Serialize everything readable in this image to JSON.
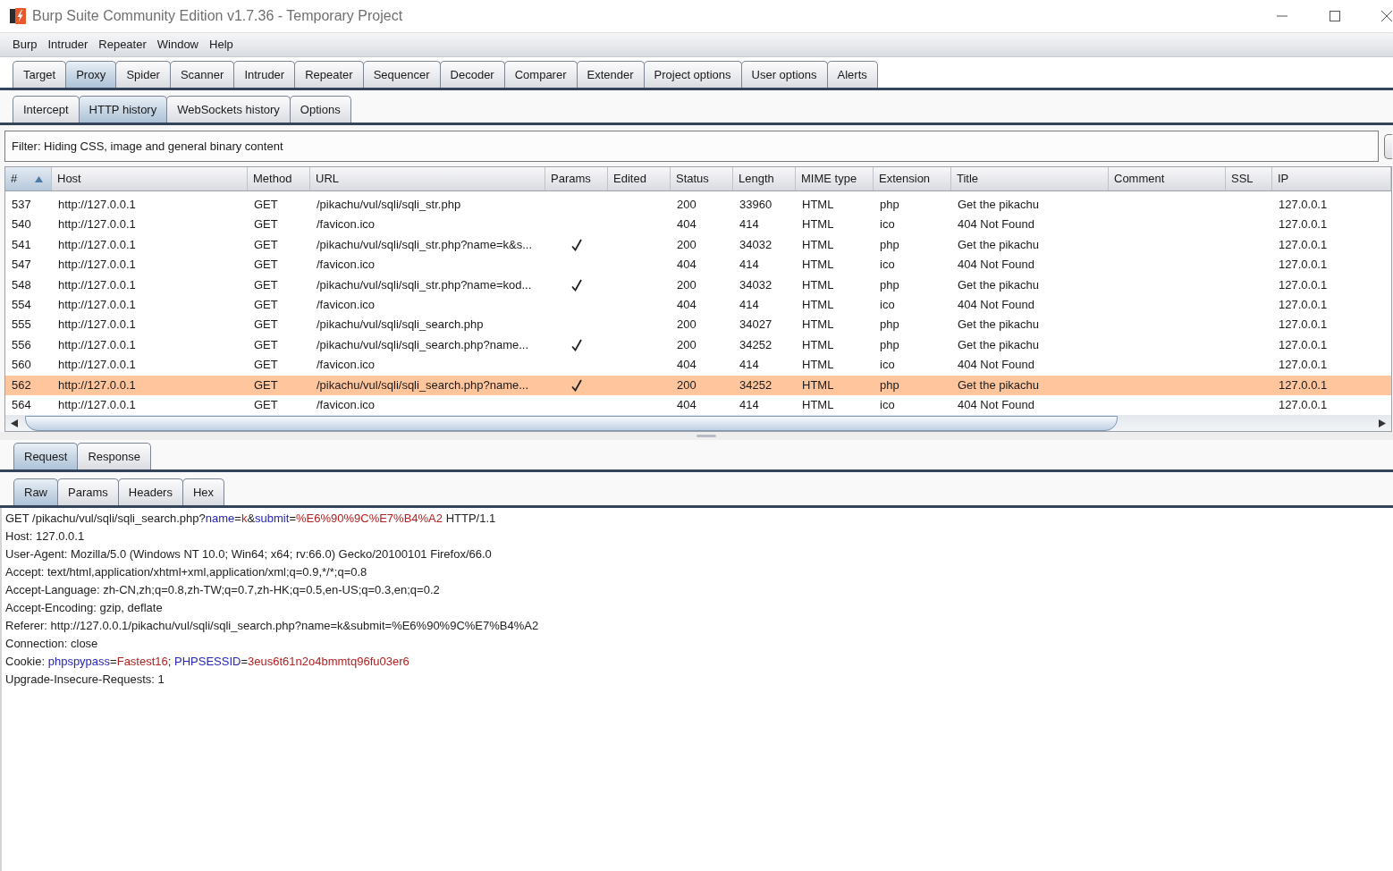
{
  "window": {
    "title": "Burp Suite Community Edition v1.7.36 - Temporary Project"
  },
  "menu": [
    "Burp",
    "Intruder",
    "Repeater",
    "Window",
    "Help"
  ],
  "main_tabs": [
    {
      "label": "Target",
      "selected": false
    },
    {
      "label": "Proxy",
      "selected": true
    },
    {
      "label": "Spider",
      "selected": false
    },
    {
      "label": "Scanner",
      "selected": false
    },
    {
      "label": "Intruder",
      "selected": false
    },
    {
      "label": "Repeater",
      "selected": false
    },
    {
      "label": "Sequencer",
      "selected": false
    },
    {
      "label": "Decoder",
      "selected": false
    },
    {
      "label": "Comparer",
      "selected": false
    },
    {
      "label": "Extender",
      "selected": false
    },
    {
      "label": "Project options",
      "selected": false
    },
    {
      "label": "User options",
      "selected": false
    },
    {
      "label": "Alerts",
      "selected": false
    }
  ],
  "proxy_tabs": [
    {
      "label": "Intercept",
      "selected": false
    },
    {
      "label": "HTTP history",
      "selected": true
    },
    {
      "label": "WebSockets history",
      "selected": false
    },
    {
      "label": "Options",
      "selected": false
    }
  ],
  "filter": {
    "text": "Filter: Hiding CSS, image and general binary content"
  },
  "history_table": {
    "columns": [
      {
        "label": "#",
        "sorted": true
      },
      {
        "label": "Host",
        "sorted": false
      },
      {
        "label": "Method",
        "sorted": false
      },
      {
        "label": "URL",
        "sorted": false
      },
      {
        "label": "Params",
        "sorted": false
      },
      {
        "label": "Edited",
        "sorted": false
      },
      {
        "label": "Status",
        "sorted": false
      },
      {
        "label": "Length",
        "sorted": false
      },
      {
        "label": "MIME type",
        "sorted": false
      },
      {
        "label": "Extension",
        "sorted": false
      },
      {
        "label": "Title",
        "sorted": false
      },
      {
        "label": "Comment",
        "sorted": false
      },
      {
        "label": "SSL",
        "sorted": false
      },
      {
        "label": "IP",
        "sorted": false
      }
    ],
    "rows": [
      {
        "number": "537",
        "host": "http://127.0.0.1",
        "method": "GET",
        "url": "/pikachu/vul/sqli/sqli_str.php",
        "params": false,
        "status": "200",
        "length": "33960",
        "mime_type": "HTML",
        "extension": "php",
        "title": "Get the pikachu",
        "ip": "127.0.0.1",
        "selected": false
      },
      {
        "number": "540",
        "host": "http://127.0.0.1",
        "method": "GET",
        "url": "/favicon.ico",
        "params": false,
        "status": "404",
        "length": "414",
        "mime_type": "HTML",
        "extension": "ico",
        "title": "404 Not Found",
        "ip": "127.0.0.1",
        "selected": false
      },
      {
        "number": "541",
        "host": "http://127.0.0.1",
        "method": "GET",
        "url": "/pikachu/vul/sqli/sqli_str.php?name=k&s...",
        "params": true,
        "status": "200",
        "length": "34032",
        "mime_type": "HTML",
        "extension": "php",
        "title": "Get the pikachu",
        "ip": "127.0.0.1",
        "selected": false
      },
      {
        "number": "547",
        "host": "http://127.0.0.1",
        "method": "GET",
        "url": "/favicon.ico",
        "params": false,
        "status": "404",
        "length": "414",
        "mime_type": "HTML",
        "extension": "ico",
        "title": "404 Not Found",
        "ip": "127.0.0.1",
        "selected": false
      },
      {
        "number": "548",
        "host": "http://127.0.0.1",
        "method": "GET",
        "url": "/pikachu/vul/sqli/sqli_str.php?name=kod...",
        "params": true,
        "status": "200",
        "length": "34032",
        "mime_type": "HTML",
        "extension": "php",
        "title": "Get the pikachu",
        "ip": "127.0.0.1",
        "selected": false
      },
      {
        "number": "554",
        "host": "http://127.0.0.1",
        "method": "GET",
        "url": "/favicon.ico",
        "params": false,
        "status": "404",
        "length": "414",
        "mime_type": "HTML",
        "extension": "ico",
        "title": "404 Not Found",
        "ip": "127.0.0.1",
        "selected": false
      },
      {
        "number": "555",
        "host": "http://127.0.0.1",
        "method": "GET",
        "url": "/pikachu/vul/sqli/sqli_search.php",
        "params": false,
        "status": "200",
        "length": "34027",
        "mime_type": "HTML",
        "extension": "php",
        "title": "Get the pikachu",
        "ip": "127.0.0.1",
        "selected": false
      },
      {
        "number": "556",
        "host": "http://127.0.0.1",
        "method": "GET",
        "url": "/pikachu/vul/sqli/sqli_search.php?name...",
        "params": true,
        "status": "200",
        "length": "34252",
        "mime_type": "HTML",
        "extension": "php",
        "title": "Get the pikachu",
        "ip": "127.0.0.1",
        "selected": false
      },
      {
        "number": "560",
        "host": "http://127.0.0.1",
        "method": "GET",
        "url": "/favicon.ico",
        "params": false,
        "status": "404",
        "length": "414",
        "mime_type": "HTML",
        "extension": "ico",
        "title": "404 Not Found",
        "ip": "127.0.0.1",
        "selected": false
      },
      {
        "number": "562",
        "host": "http://127.0.0.1",
        "method": "GET",
        "url": "/pikachu/vul/sqli/sqli_search.php?name...",
        "params": true,
        "status": "200",
        "length": "34252",
        "mime_type": "HTML",
        "extension": "php",
        "title": "Get the pikachu",
        "ip": "127.0.0.1",
        "selected": true
      },
      {
        "number": "564",
        "host": "http://127.0.0.1",
        "method": "GET",
        "url": "/favicon.ico",
        "params": false,
        "status": "404",
        "length": "414",
        "mime_type": "HTML",
        "extension": "ico",
        "title": "404 Not Found",
        "ip": "127.0.0.1",
        "selected": false
      }
    ]
  },
  "message_tabs": [
    {
      "label": "Request",
      "selected": true
    },
    {
      "label": "Response",
      "selected": false
    }
  ],
  "view_tabs": [
    {
      "label": "Raw",
      "selected": true
    },
    {
      "label": "Params",
      "selected": false
    },
    {
      "label": "Headers",
      "selected": false
    },
    {
      "label": "Hex",
      "selected": false
    }
  ],
  "request_editor": {
    "lines": [
      {
        "segments": [
          {
            "kind": "text",
            "text": "GET /pikachu/vul/sqli/sqli_search.php?"
          },
          {
            "kind": "param_name",
            "text": "name"
          },
          {
            "kind": "text",
            "text": "="
          },
          {
            "kind": "param_value",
            "text": "k"
          },
          {
            "kind": "text",
            "text": "&"
          },
          {
            "kind": "param_name",
            "text": "submit"
          },
          {
            "kind": "text",
            "text": "="
          },
          {
            "kind": "param_value",
            "text": "%E6%90%9C%E7%B4%A2"
          },
          {
            "kind": "text",
            "text": " HTTP/1.1"
          }
        ]
      },
      {
        "segments": [
          {
            "kind": "text",
            "text": "Host: 127.0.0.1"
          }
        ]
      },
      {
        "segments": [
          {
            "kind": "text",
            "text": "User-Agent: Mozilla/5.0 (Windows NT 10.0; Win64; x64; rv:66.0) Gecko/20100101 Firefox/66.0"
          }
        ]
      },
      {
        "segments": [
          {
            "kind": "text",
            "text": "Accept: text/html,application/xhtml+xml,application/xml;q=0.9,*/*;q=0.8"
          }
        ]
      },
      {
        "segments": [
          {
            "kind": "text",
            "text": "Accept-Language: zh-CN,zh;q=0.8,zh-TW;q=0.7,zh-HK;q=0.5,en-US;q=0.3,en;q=0.2"
          }
        ]
      },
      {
        "segments": [
          {
            "kind": "text",
            "text": "Accept-Encoding: gzip, deflate"
          }
        ]
      },
      {
        "segments": [
          {
            "kind": "text",
            "text": "Referer: http://127.0.0.1/pikachu/vul/sqli/sqli_search.php?name=k&submit=%E6%90%9C%E7%B4%A2"
          }
        ]
      },
      {
        "segments": [
          {
            "kind": "text",
            "text": "Connection: close"
          }
        ]
      },
      {
        "segments": [
          {
            "kind": "text",
            "text": "Cookie: "
          },
          {
            "kind": "param_name",
            "text": "phpspypass"
          },
          {
            "kind": "text",
            "text": "="
          },
          {
            "kind": "param_value",
            "text": "Fastest16"
          },
          {
            "kind": "text",
            "text": "; "
          },
          {
            "kind": "param_name",
            "text": "PHPSESSID"
          },
          {
            "kind": "text",
            "text": "="
          },
          {
            "kind": "param_value",
            "text": "3eus6t61n2o4bmmtq96fu03er6"
          }
        ]
      },
      {
        "segments": [
          {
            "kind": "text",
            "text": "Upgrade-Insecure-Requests: 1"
          }
        ]
      }
    ]
  }
}
